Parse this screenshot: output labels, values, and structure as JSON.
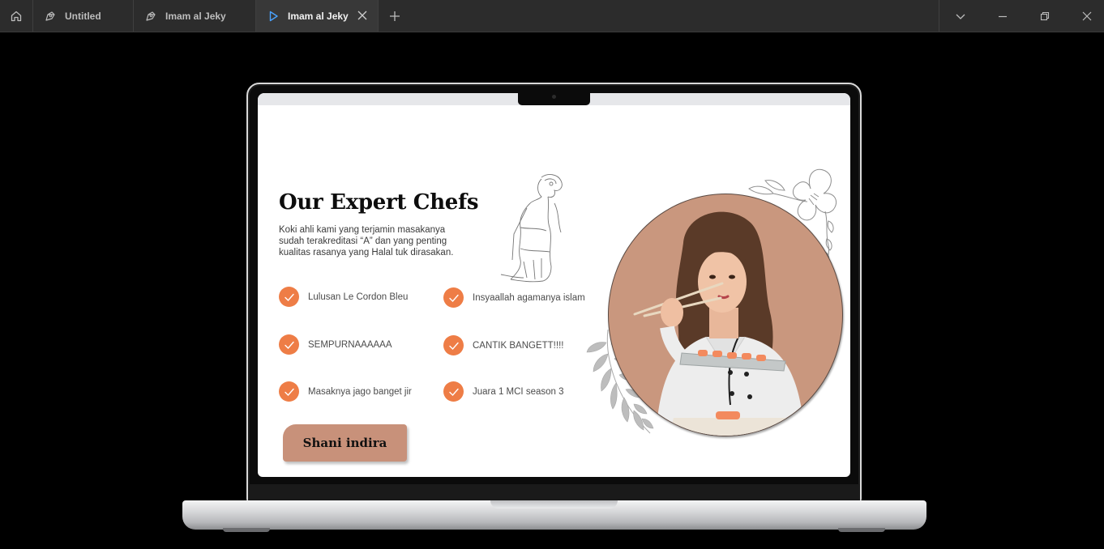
{
  "tabs": [
    {
      "label": "Untitled",
      "icon": "figma-file-icon",
      "active": false
    },
    {
      "label": "Imam al Jeky",
      "icon": "figma-file-icon",
      "active": false
    },
    {
      "label": "Imam al Jeky",
      "icon": "play-prototype-icon",
      "active": true
    }
  ],
  "colors": {
    "accent": "#ee7d46",
    "portrait_bg": "#c9977e",
    "button_bg": "#c8917a",
    "titlebar": "#2c2c2c"
  },
  "page": {
    "title": "Our Expert Chefs",
    "description": "Koki ahli kami yang terjamin masakanya sudah terakreditasi “A” dan yang penting kualitas rasanya yang Halal tuk dirasakan.",
    "features": [
      "Lulusan Le Cordon Bleu",
      "Insyaallah agamanya islam",
      "SEMPURNAAAAAA",
      "CANTIK BANGETT!!!!",
      "Masaknya jago banget jir",
      "Juara 1 MCI season 3"
    ],
    "chef_name": "Shani indira"
  }
}
